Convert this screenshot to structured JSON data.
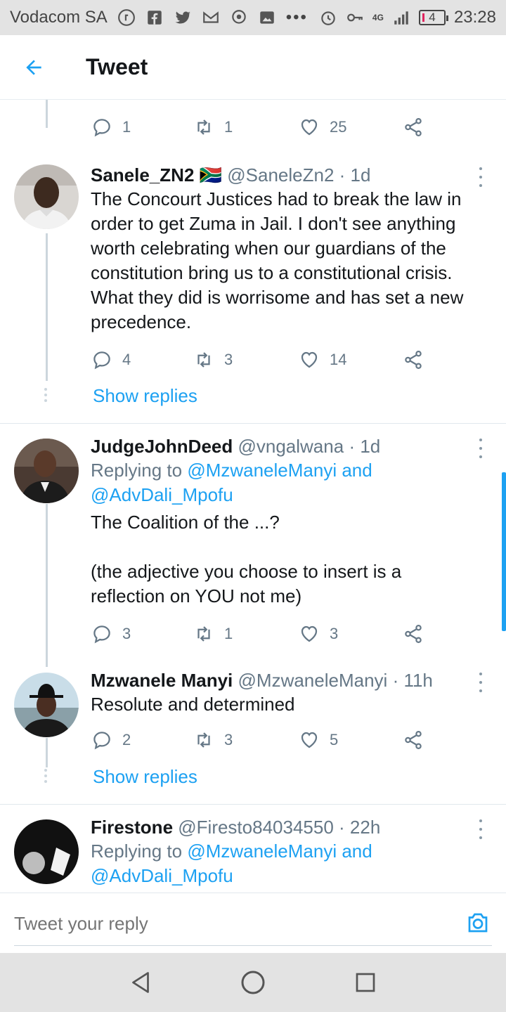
{
  "status_bar": {
    "carrier": "Vodacom SA",
    "network": "4G",
    "battery": "4",
    "time": "23:28"
  },
  "header": {
    "title": "Tweet"
  },
  "actions_top": {
    "replies": "1",
    "retweets": "1",
    "likes": "25"
  },
  "tweets": [
    {
      "name": "Sanele_ZN2",
      "flag": "🇿🇦",
      "handle": "@SaneleZn2",
      "time": "· 1d",
      "text_lines": [
        "The Concourt Justices had to break the law in",
        "order to get Zuma in Jail. I don't see anything",
        "worth celebrating when our guardians of the",
        "constitution bring us to a constitutional crisis.",
        "What they did is worrisome and has set a new",
        "precedence."
      ],
      "replies": "4",
      "retweets": "3",
      "likes": "14",
      "show_replies": "Show replies"
    },
    {
      "name": "JudgeJohnDeed",
      "handle": "@vngalwana",
      "time": "· 1d",
      "replying_prefix": "Replying to ",
      "replying_1": "@MzwaneleManyi",
      "replying_and": " and",
      "replying_2": "@AdvDali_Mpofu",
      "text_lines": [
        "The Coalition of the ...?",
        "",
        "(the adjective you choose to insert is a",
        "reflection on YOU not me)"
      ],
      "replies": "3",
      "retweets": "1",
      "likes": "3"
    },
    {
      "name": "Mzwanele Manyi",
      "handle": "@MzwaneleManyi",
      "time": "· 11h",
      "text_lines": [
        "Resolute and determined"
      ],
      "replies": "2",
      "retweets": "3",
      "likes": "5",
      "show_replies": "Show replies"
    },
    {
      "name": "Firestone",
      "handle": "@Firesto84034550",
      "time": "· 22h",
      "replying_prefix": "Replying to ",
      "replying_1": "@MzwaneleManyi",
      "replying_and": " and",
      "replying_2": "@AdvDali_Mpofu"
    }
  ],
  "reply_bar": {
    "placeholder": "Tweet your reply"
  },
  "colors": {
    "accent": "#1da1f2",
    "text": "#14171a",
    "muted": "#657786"
  },
  "icons": [
    "back-arrow-icon",
    "reply-icon",
    "retweet-icon",
    "like-icon",
    "share-icon",
    "more-icon",
    "camera-icon",
    "nav-back-icon",
    "nav-home-icon",
    "nav-recents-icon"
  ]
}
